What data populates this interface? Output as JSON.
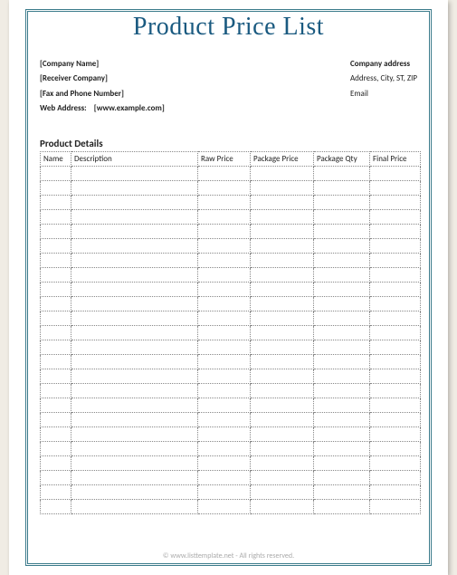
{
  "title": "Product Price List",
  "sender": {
    "company": "[Company Name]",
    "receiver": "[Receiver Company]",
    "fax_phone": "[Fax and Phone Number]",
    "web_label": "Web Address:",
    "web_value": "[www.example.com]"
  },
  "address": {
    "heading": "Company address",
    "line": "Address, City, ST, ZIP",
    "email": "Email"
  },
  "section_heading": "Product Details",
  "table": {
    "headers": {
      "name": "Name",
      "description": "Description",
      "raw_price": "Raw Price",
      "package_price": "Package Price",
      "package_qty": "Package Qty",
      "final_price": "Final Price"
    },
    "empty_rows": 24
  },
  "footer": "© www.listtemplate.net - All rights reserved."
}
